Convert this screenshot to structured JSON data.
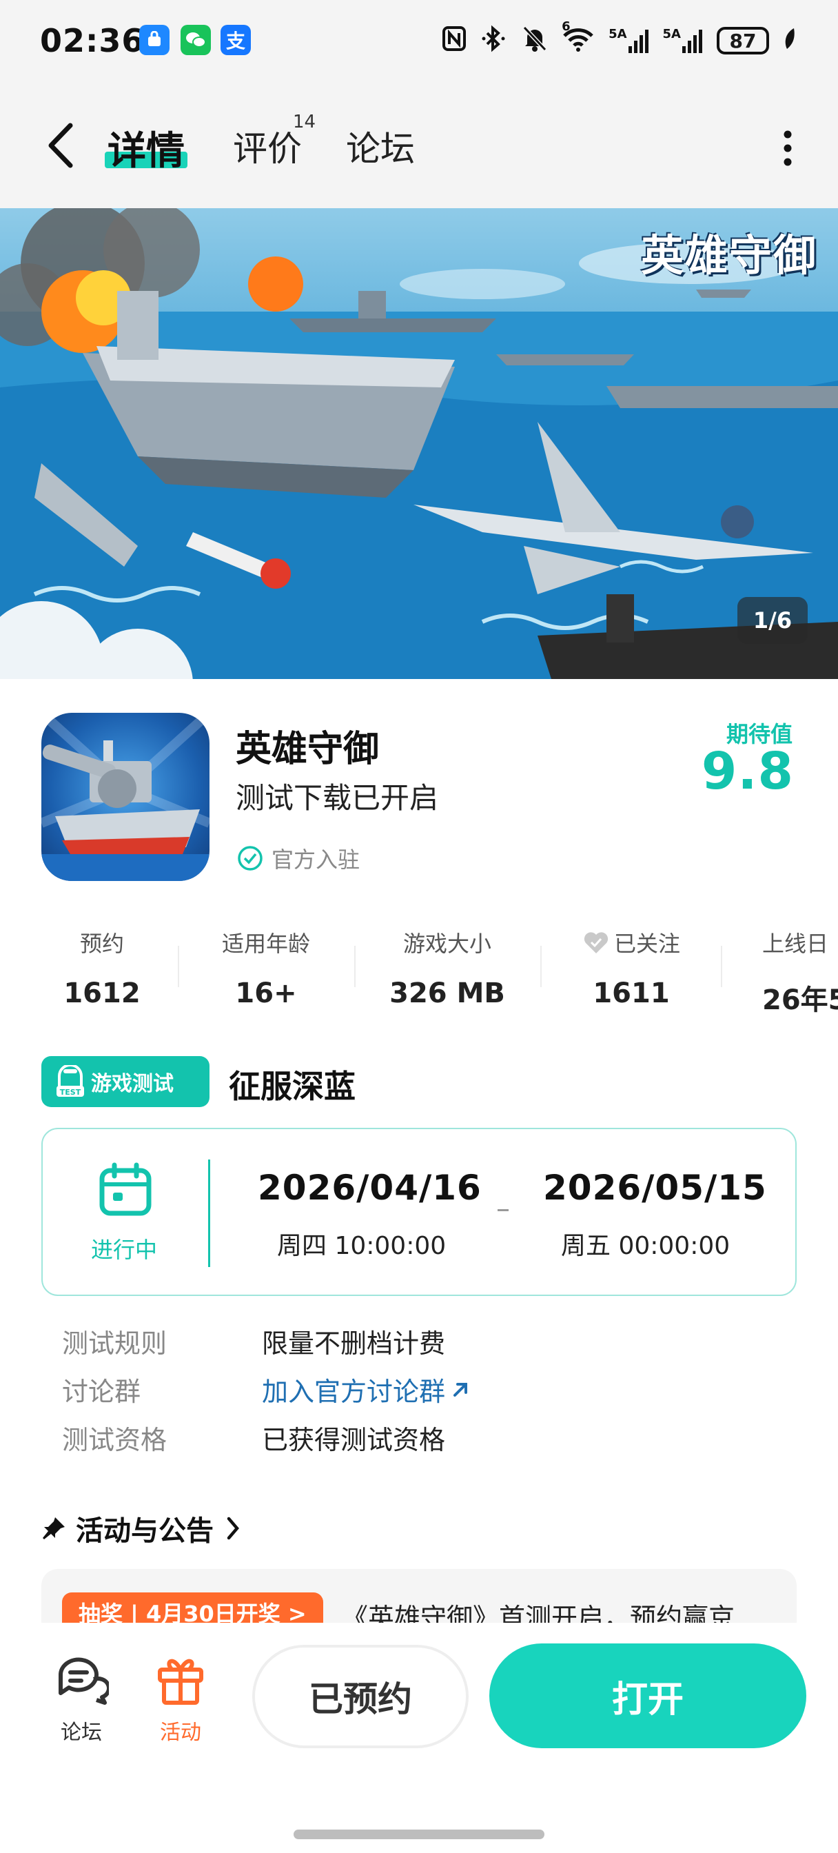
{
  "status_bar": {
    "time": "02:36",
    "battery": "87",
    "signal_1": "5A",
    "signal_2": "5A",
    "wifi_badge": "6"
  },
  "nav": {
    "tabs": [
      {
        "label": "详情",
        "active": true
      },
      {
        "label": "评价",
        "badge": "14"
      },
      {
        "label": "论坛"
      }
    ]
  },
  "banner": {
    "title": "英雄守御",
    "counter": "1/6"
  },
  "app": {
    "name": "英雄守御",
    "subtitle": "测试下载已开启",
    "verified": "官方入驻",
    "score_label": "期待值",
    "score": "9.8"
  },
  "stats": [
    {
      "label": "预约",
      "value": "1612"
    },
    {
      "label": "适用年龄",
      "value": "16+"
    },
    {
      "label": "游戏大小",
      "value": "326 MB"
    },
    {
      "label": "已关注",
      "value": "1611"
    },
    {
      "label": "上线日",
      "value": "26年5"
    }
  ],
  "test": {
    "badge": "游戏测试",
    "title": "征服深蓝",
    "status": "进行中",
    "start_date": "2026/04/16",
    "start_time": "周四  10:00:00",
    "end_date": "2026/05/15",
    "end_time": "周五  00:00:00",
    "rules": [
      {
        "label": "测试规则",
        "value": "限量不删档计费"
      },
      {
        "label": "讨论群",
        "value": "加入官方讨论群",
        "link": true
      },
      {
        "label": "测试资格",
        "value": "已获得测试资格"
      }
    ]
  },
  "activity": {
    "title": "活动与公告",
    "tag": "抽奖 | 4月30日开奖 >",
    "text": "《英雄守御》首测开启，预约赢京"
  },
  "bottom": {
    "forum_label": "论坛",
    "activity_label": "活动",
    "reserved_label": "已预约",
    "open_label": "打开"
  },
  "colors": {
    "accent": "#13c3ad",
    "orange": "#ff6a2c",
    "link": "#1f6fb2"
  }
}
